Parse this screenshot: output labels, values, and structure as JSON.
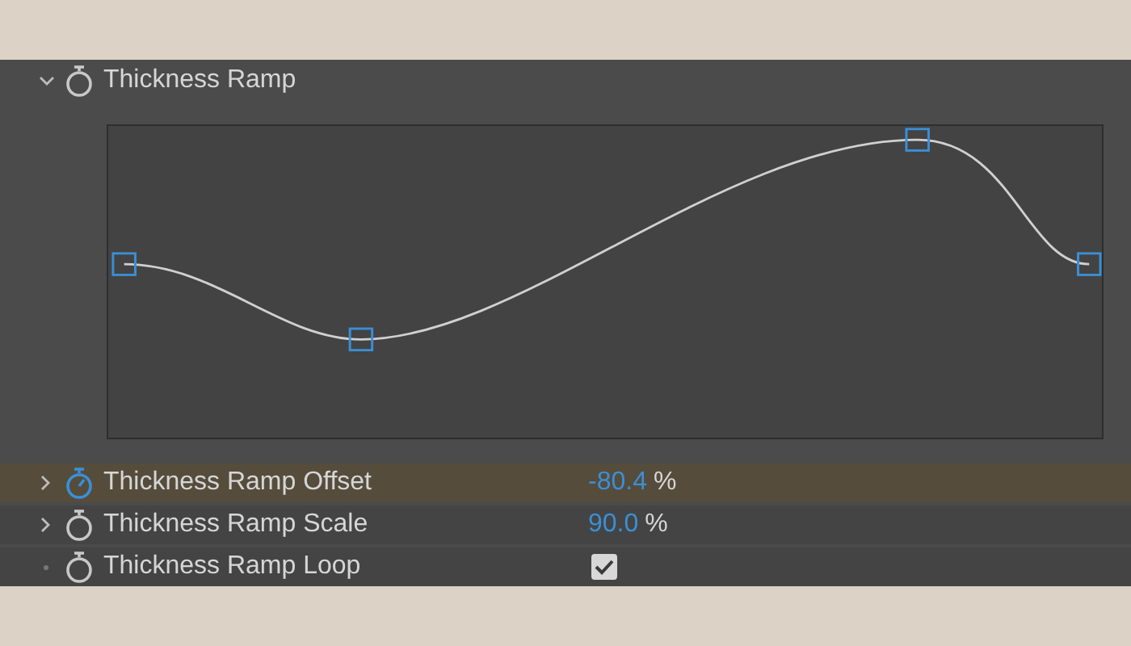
{
  "effect": {
    "label": "Thickness Ramp",
    "expanded": true
  },
  "properties": [
    {
      "kind": "number",
      "label": "Thickness Ramp Offset",
      "value": "-80.4",
      "unit": "%",
      "selected": true,
      "keyframed": true
    },
    {
      "kind": "number",
      "label": "Thickness Ramp Scale",
      "value": "90.0",
      "unit": "%",
      "selected": false,
      "keyframed": false
    },
    {
      "kind": "checkbox",
      "label": "Thickness Ramp Loop",
      "checked": true,
      "selected": false,
      "keyframed": false
    }
  ]
}
